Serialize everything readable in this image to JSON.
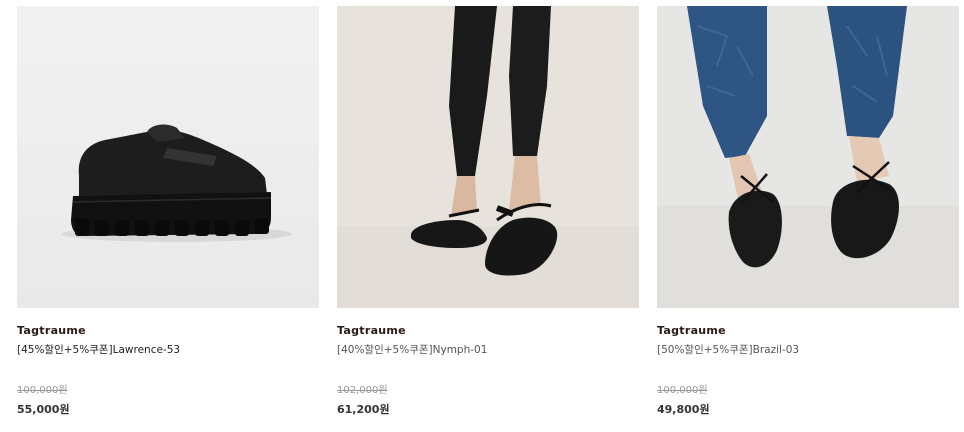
{
  "products": [
    {
      "brand": "Tagtraume",
      "name": "[45%할인+5%쿠폰]Lawrence-53",
      "original_price": "100,000원",
      "sale_price": "55,000원"
    },
    {
      "brand": "Tagtraume",
      "name": "[40%할인+5%쿠폰]Nymph-01",
      "original_price": "102,000원",
      "sale_price": "61,200원"
    },
    {
      "brand": "Tagtraume",
      "name": "[50%할인+5%쿠폰]Brazil-03",
      "original_price": "100,000원",
      "sale_price": "49,800원"
    }
  ],
  "colors": {
    "brand_text": "#2a1a14",
    "price_text": "#333333",
    "strike_text": "#999999"
  }
}
